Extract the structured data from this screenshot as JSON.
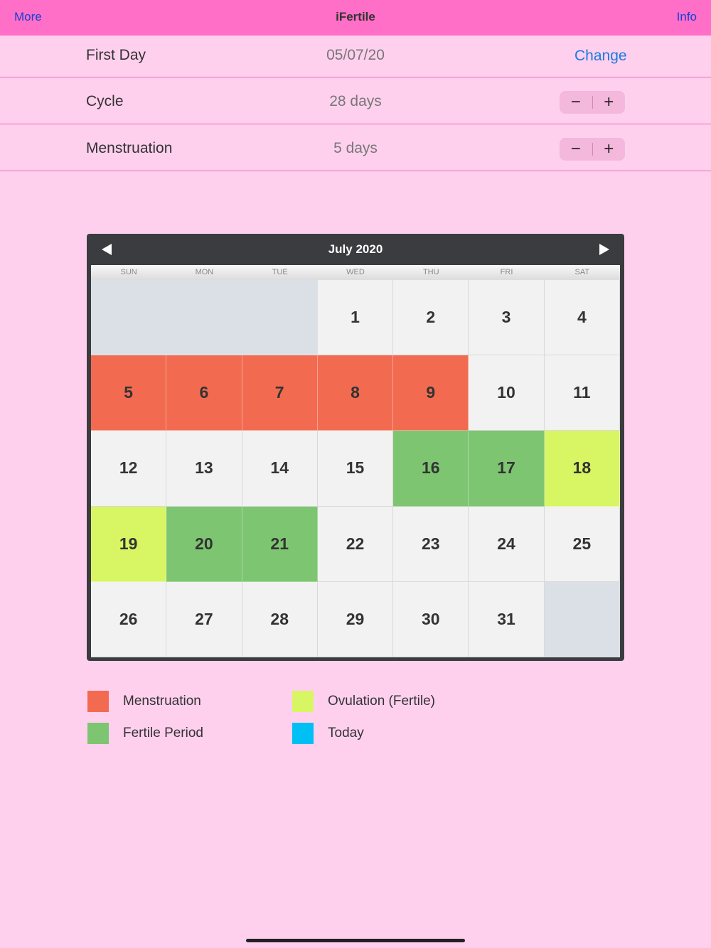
{
  "navbar": {
    "left_label": "More",
    "title": "iFertile",
    "right_label": "Info"
  },
  "settings": {
    "first_day": {
      "label": "First Day",
      "value": "05/07/20",
      "action": "Change"
    },
    "cycle": {
      "label": "Cycle",
      "value": "28 days",
      "minus": "−",
      "plus": "+"
    },
    "menstruation": {
      "label": "Menstruation",
      "value": "5 days",
      "minus": "−",
      "plus": "+"
    }
  },
  "calendar": {
    "title": "July 2020",
    "weekdays": [
      "SUN",
      "MON",
      "TUE",
      "WED",
      "THU",
      "FRI",
      "SAT"
    ],
    "leading_empty": 3,
    "trailing_empty": 1,
    "days": [
      {
        "n": "1",
        "type": "normal"
      },
      {
        "n": "2",
        "type": "normal"
      },
      {
        "n": "3",
        "type": "normal"
      },
      {
        "n": "4",
        "type": "normal"
      },
      {
        "n": "5",
        "type": "menstruation"
      },
      {
        "n": "6",
        "type": "menstruation"
      },
      {
        "n": "7",
        "type": "menstruation"
      },
      {
        "n": "8",
        "type": "menstruation"
      },
      {
        "n": "9",
        "type": "menstruation"
      },
      {
        "n": "10",
        "type": "normal"
      },
      {
        "n": "11",
        "type": "normal"
      },
      {
        "n": "12",
        "type": "normal"
      },
      {
        "n": "13",
        "type": "normal"
      },
      {
        "n": "14",
        "type": "normal"
      },
      {
        "n": "15",
        "type": "normal"
      },
      {
        "n": "16",
        "type": "fertile"
      },
      {
        "n": "17",
        "type": "fertile"
      },
      {
        "n": "18",
        "type": "ovulation"
      },
      {
        "n": "19",
        "type": "ovulation"
      },
      {
        "n": "20",
        "type": "fertile"
      },
      {
        "n": "21",
        "type": "fertile"
      },
      {
        "n": "22",
        "type": "normal"
      },
      {
        "n": "23",
        "type": "normal"
      },
      {
        "n": "24",
        "type": "normal"
      },
      {
        "n": "25",
        "type": "normal"
      },
      {
        "n": "26",
        "type": "normal"
      },
      {
        "n": "27",
        "type": "normal"
      },
      {
        "n": "28",
        "type": "normal"
      },
      {
        "n": "29",
        "type": "normal"
      },
      {
        "n": "30",
        "type": "normal"
      },
      {
        "n": "31",
        "type": "normal"
      }
    ]
  },
  "legend": {
    "menstruation": {
      "label": "Menstruation",
      "color": "#f26b51"
    },
    "fertile": {
      "label": "Fertile Period",
      "color": "#7ec572"
    },
    "ovulation": {
      "label": "Ovulation (Fertile)",
      "color": "#d8f563"
    },
    "today": {
      "label": "Today",
      "color": "#00bff5"
    }
  }
}
